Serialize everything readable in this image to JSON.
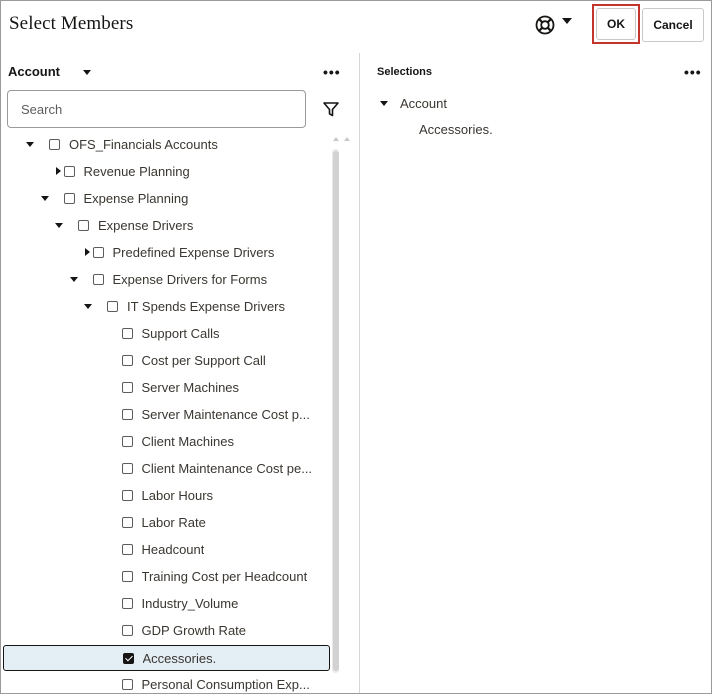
{
  "dialog": {
    "title": "Select Members",
    "help_icon": "lifebuoy-icon",
    "ok_label": "OK",
    "cancel_label": "Cancel",
    "highlight_color": "#c3352b"
  },
  "left_panel": {
    "dimension": "Account",
    "more_icon": "more-horizontal-icon",
    "search_placeholder": "Search",
    "filter_icon": "filter-icon"
  },
  "tree": [
    {
      "label": "OFS_Financials Accounts",
      "expander": "expanded",
      "checked": false
    },
    {
      "label": "Revenue Planning",
      "expander": "collapsed",
      "checked": false
    },
    {
      "label": "Expense Planning",
      "expander": "expanded",
      "checked": false
    },
    {
      "label": "Expense Drivers",
      "expander": "expanded",
      "checked": false
    },
    {
      "label": "Predefined Expense Drivers",
      "expander": "collapsed",
      "checked": false
    },
    {
      "label": "Expense Drivers for Forms",
      "expander": "expanded",
      "checked": false
    },
    {
      "label": "IT Spends Expense Drivers",
      "expander": "expanded",
      "checked": false
    },
    {
      "label": "Support Calls",
      "expander": "none",
      "checked": false
    },
    {
      "label": "Cost per Support Call",
      "expander": "none",
      "checked": false
    },
    {
      "label": "Server Machines",
      "expander": "none",
      "checked": false
    },
    {
      "label": "Server Maintenance Cost p...",
      "expander": "none",
      "checked": false
    },
    {
      "label": "Client Machines",
      "expander": "none",
      "checked": false
    },
    {
      "label": "Client Maintenance Cost pe...",
      "expander": "none",
      "checked": false
    },
    {
      "label": "Labor Hours",
      "expander": "none",
      "checked": false
    },
    {
      "label": "Labor Rate",
      "expander": "none",
      "checked": false
    },
    {
      "label": "Headcount",
      "expander": "none",
      "checked": false
    },
    {
      "label": "Training Cost per Headcount",
      "expander": "none",
      "checked": false
    },
    {
      "label": "Industry_Volume",
      "expander": "none",
      "checked": false
    },
    {
      "label": "GDP Growth Rate",
      "expander": "none",
      "checked": false
    },
    {
      "label": "Accessories.",
      "expander": "none",
      "checked": true,
      "selected": true
    },
    {
      "label": "Personal Consumption Exp...",
      "expander": "none",
      "checked": false
    }
  ],
  "right_panel": {
    "title": "Selections",
    "more_icon": "more-horizontal-icon",
    "group_label": "Account",
    "items": [
      "Accessories."
    ]
  }
}
